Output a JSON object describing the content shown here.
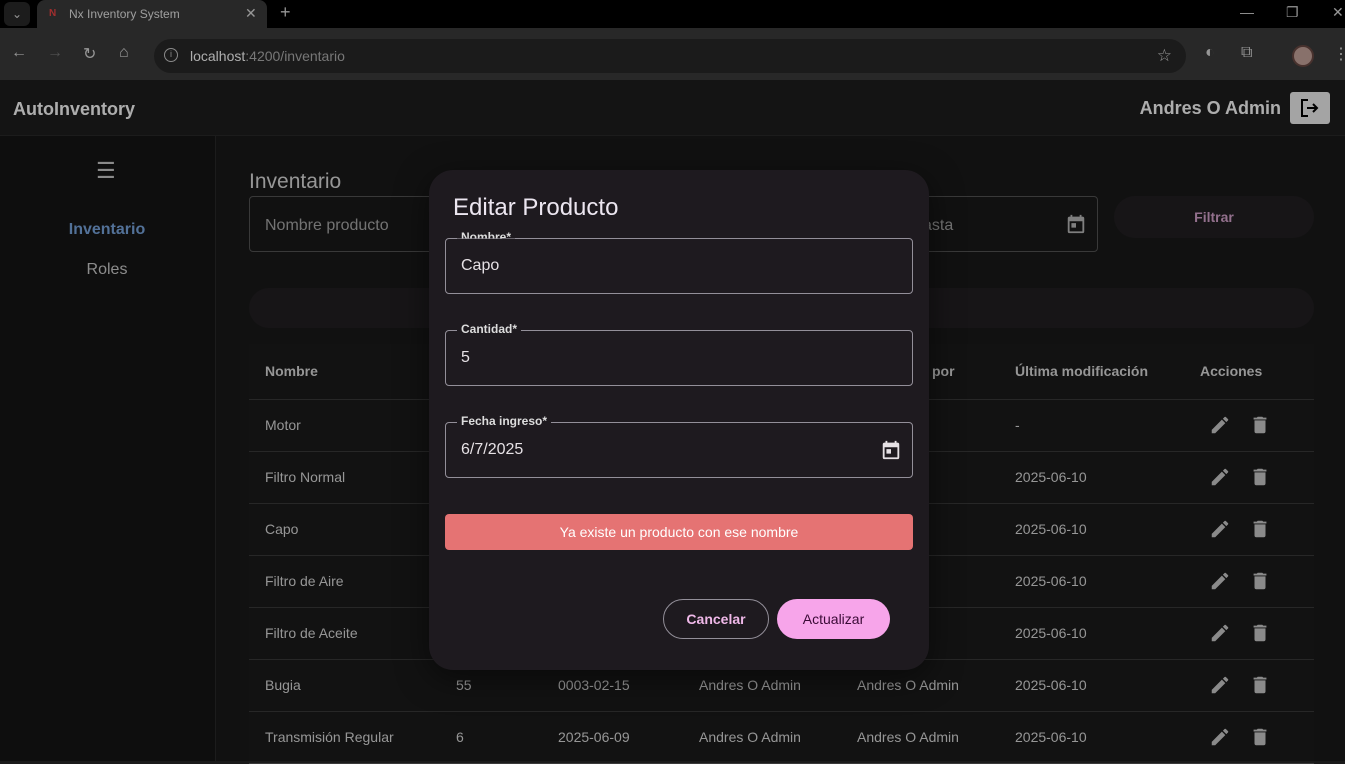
{
  "browser": {
    "tab_title": "Nx Inventory System",
    "url_host": "localhost",
    "url_rest": ":4200/inventario"
  },
  "app": {
    "title": "AutoInventory",
    "user": "Andres O Admin"
  },
  "sidebar": {
    "items": [
      {
        "label": "Inventario",
        "active": true
      },
      {
        "label": "Roles",
        "active": false
      }
    ]
  },
  "main": {
    "page_title": "Inventario",
    "filter_name_placeholder": "Nombre producto",
    "filter_hasta_label": "asta",
    "filter_button": "Filtrar"
  },
  "table": {
    "headers": {
      "nombre": "Nombre",
      "por": "por",
      "modificacion": "Última modificación",
      "acciones": "Acciones"
    },
    "rows": [
      {
        "nombre": "Motor",
        "cantidad": "",
        "fecha": "",
        "creado": "",
        "modificado": "",
        "ultima": "-"
      },
      {
        "nombre": "Filtro Normal",
        "cantidad": "",
        "fecha": "",
        "creado": "",
        "modificado": "dmin",
        "ultima": "2025-06-10"
      },
      {
        "nombre": "Capo",
        "cantidad": "",
        "fecha": "",
        "creado": "",
        "modificado": "dmin",
        "ultima": "2025-06-10"
      },
      {
        "nombre": "Filtro de Aire",
        "cantidad": "",
        "fecha": "",
        "creado": "",
        "modificado": "dmin",
        "ultima": "2025-06-10"
      },
      {
        "nombre": "Filtro de Aceite",
        "cantidad": "",
        "fecha": "",
        "creado": "",
        "modificado": "dmin",
        "ultima": "2025-06-10"
      },
      {
        "nombre": "Bugia",
        "cantidad": "55",
        "fecha": "0003-02-15",
        "creado": "Andres O Admin",
        "modificado": "Andres O Admin",
        "ultima": "2025-06-10"
      },
      {
        "nombre": "Transmisión Regular",
        "cantidad": "6",
        "fecha": "2025-06-09",
        "creado": "Andres O Admin",
        "modificado": "Andres O Admin",
        "ultima": "2025-06-10"
      }
    ]
  },
  "dialog": {
    "title": "Editar Producto",
    "fields": {
      "nombre": {
        "label": "Nombre*",
        "value": "Capo"
      },
      "cantidad": {
        "label": "Cantidad*",
        "value": "5"
      },
      "fecha": {
        "label": "Fecha ingreso*",
        "value": "6/7/2025"
      }
    },
    "error": "Ya existe un producto con ese nombre",
    "cancel_label": "Cancelar",
    "update_label": "Actualizar"
  },
  "colors": {
    "accent": "#f7a5ea",
    "error": "#e57373",
    "active_nav": "#7aa7e0"
  }
}
